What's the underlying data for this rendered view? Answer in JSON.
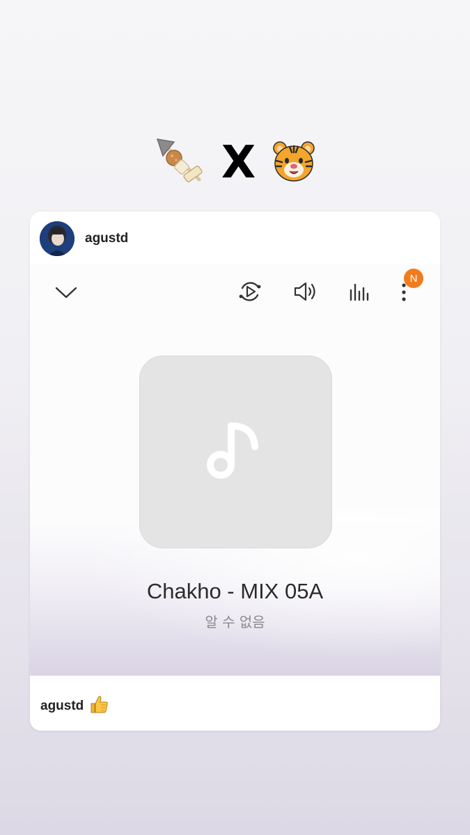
{
  "caption": {
    "text": "X",
    "left_emoji": "oden-skewer-emoji",
    "right_emoji": "tiger-face-emoji"
  },
  "post": {
    "username": "agustd"
  },
  "player": {
    "icons": {
      "collapse": "chevron-down-icon",
      "repeat": "repeat-play-icon",
      "volume": "volume-icon",
      "equalizer": "equalizer-icon",
      "more": "more-vert-icon",
      "album_placeholder": "music-note-icon"
    },
    "badge": "N",
    "track_title": "Chakho - MIX 05A",
    "track_artist": "알 수 없음"
  },
  "footer": {
    "username": "agustd",
    "emoji": "thumbs-up-emoji"
  },
  "colors": {
    "badge": "#f07c1e",
    "album_bg": "#e4e4e5",
    "title_text": "#2b2b2b",
    "subtitle_text": "#8a8a8e"
  }
}
